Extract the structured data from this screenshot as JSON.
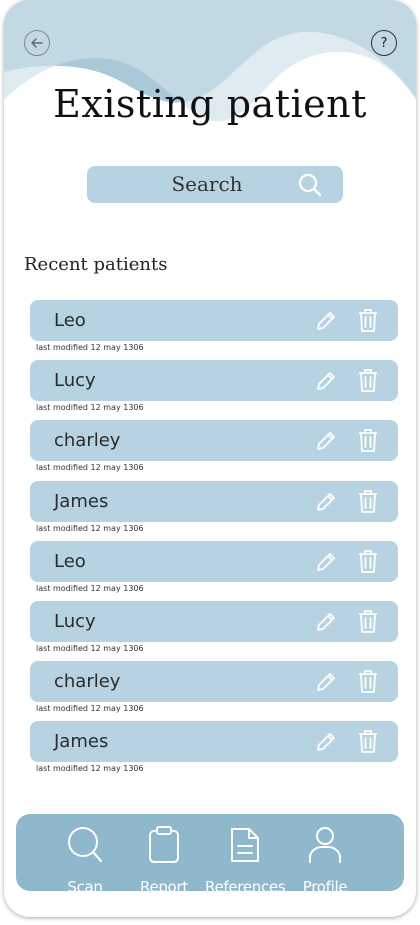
{
  "header": {
    "title": "Existing patient",
    "help_symbol": "?",
    "back_icon": "arrow-left-icon"
  },
  "search": {
    "label": "Search"
  },
  "recent": {
    "label": "Recent patients",
    "patients": [
      {
        "name": "Leo",
        "modified": "last modified 12 may 1306"
      },
      {
        "name": "Lucy",
        "modified": "last modified 12 may 1306"
      },
      {
        "name": "charley",
        "modified": "last modified 12 may 1306"
      },
      {
        "name": "James",
        "modified": "last modified 12 may 1306"
      },
      {
        "name": "Leo",
        "modified": "last modified 12 may 1306"
      },
      {
        "name": "Lucy",
        "modified": "last modified 12 may 1306"
      },
      {
        "name": "charley",
        "modified": "last modified 12 may 1306"
      },
      {
        "name": "James",
        "modified": "last modified 12 may 1306"
      }
    ]
  },
  "tabbar": {
    "tabs": [
      {
        "label": "Scan",
        "icon": "search-icon"
      },
      {
        "label": "Report",
        "icon": "clipboard-icon"
      },
      {
        "label": "References",
        "icon": "document-icon"
      },
      {
        "label": "Profile",
        "icon": "user-icon"
      }
    ]
  },
  "colors": {
    "accent": "#b7d3e1",
    "tabbar": "#8fb8cc",
    "wave_dark": "#a9c8d8",
    "wave_light": "#cfe1ea"
  }
}
